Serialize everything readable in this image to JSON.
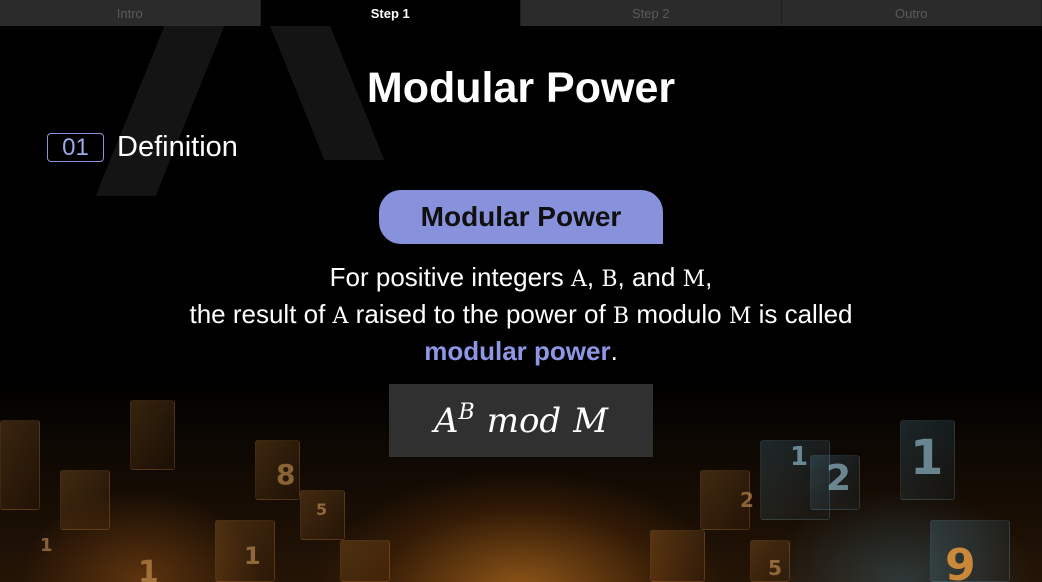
{
  "tabs": [
    {
      "label": "Intro",
      "active": false
    },
    {
      "label": "Step 1",
      "active": true
    },
    {
      "label": "Step 2",
      "active": false
    },
    {
      "label": "Outro",
      "active": false
    }
  ],
  "title": "Modular Power",
  "section": {
    "number": "01",
    "label": "Definition"
  },
  "pill_label": "Modular Power",
  "description": {
    "line1_a": "For positive integers ",
    "var_a": "A",
    "sep1": ", ",
    "var_b": "B",
    "sep2": ", and ",
    "var_m": "M",
    "sep3": ",",
    "line2_a": "the result of ",
    "line2_var_a": "A",
    "line2_b": " raised to the power of ",
    "line2_var_b": "B",
    "line2_c": " modulo ",
    "line2_var_m": "M",
    "line2_d": " is called",
    "line3_highlight": "modular power",
    "line3_end": "."
  },
  "formula": {
    "base": "A",
    "exponent": "B",
    "op": "mod",
    "modulus": "M"
  },
  "background_digits": [
    "1",
    "8",
    "5",
    "1",
    "2",
    "1",
    "2",
    "1",
    "9",
    "5",
    "1"
  ],
  "colors": {
    "accent": "#8791dc",
    "highlight_text": "#8d97e6",
    "tab_bg": "#2b2b2b",
    "tab_active_bg": "#000000"
  }
}
